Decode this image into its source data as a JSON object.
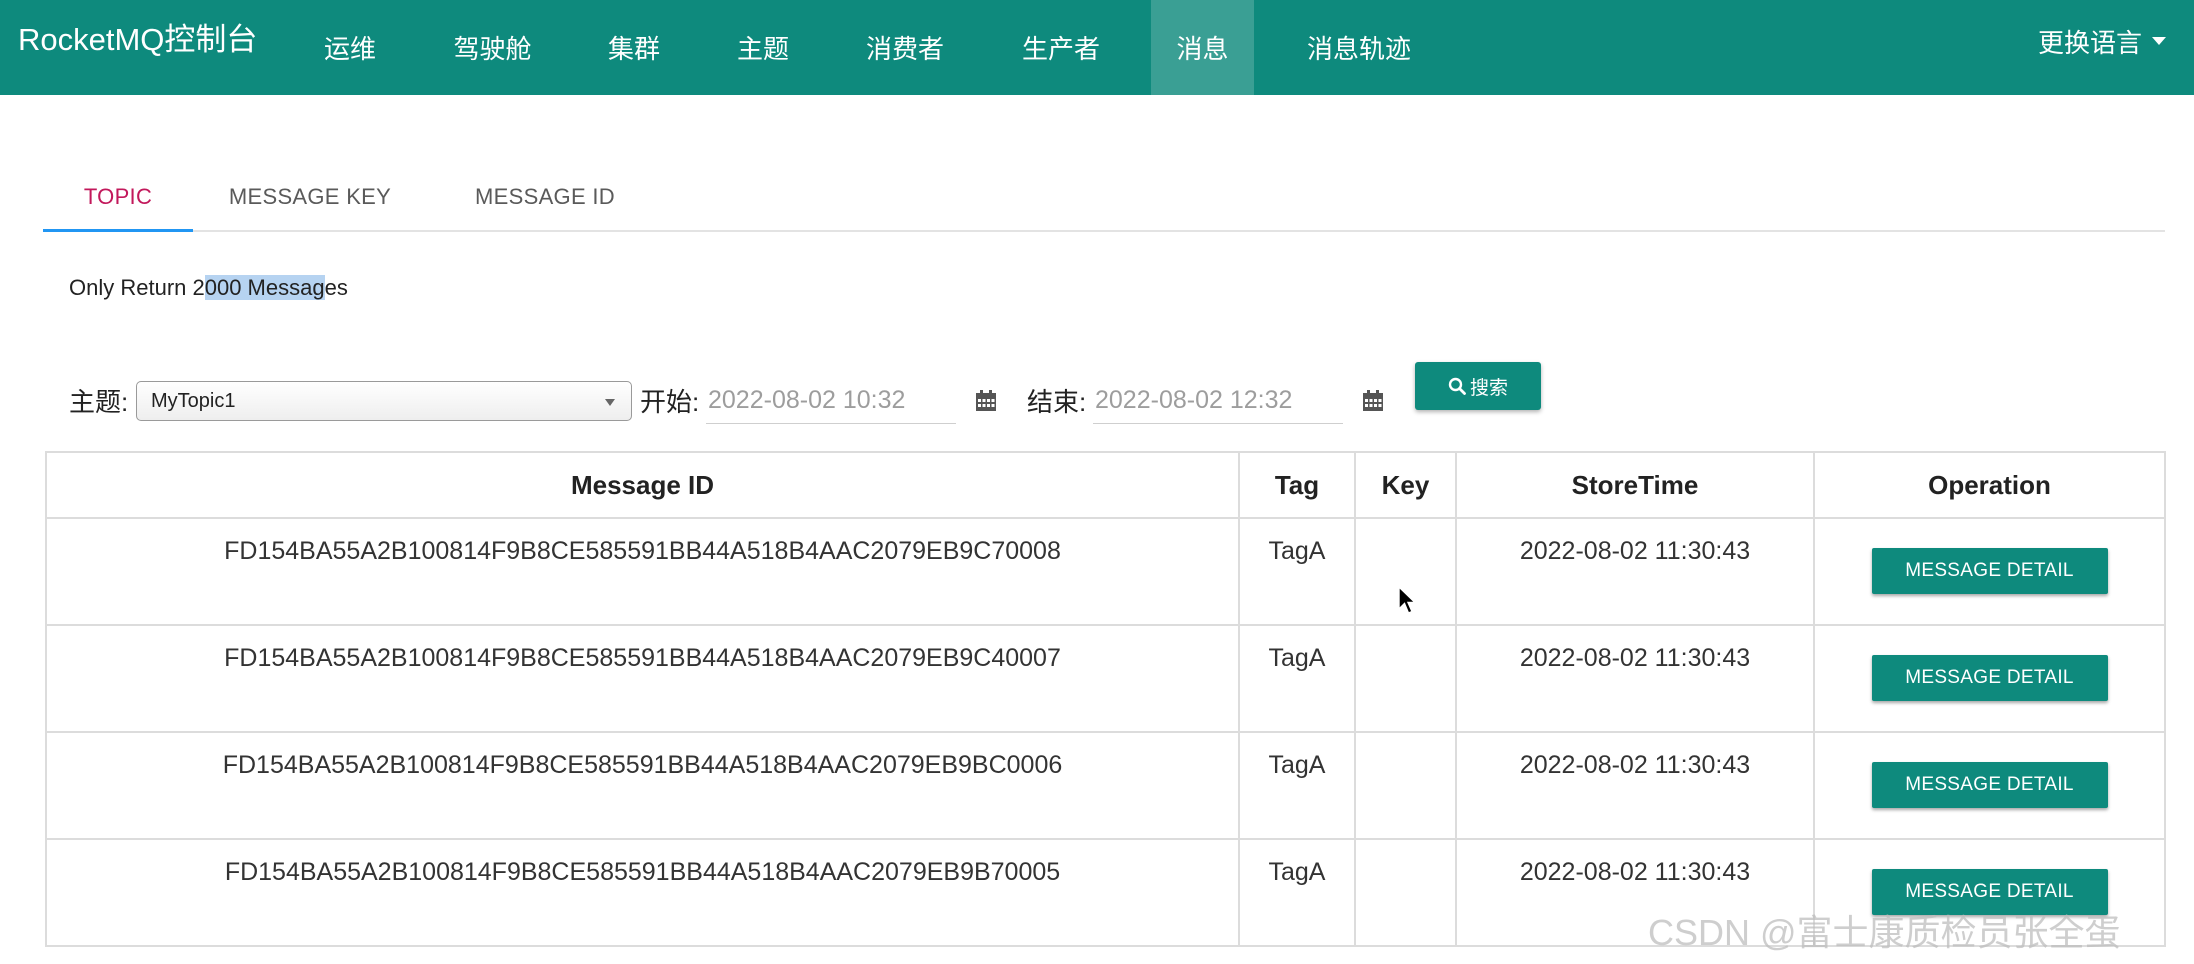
{
  "navbar": {
    "brand": "RocketMQ控制台",
    "items": [
      {
        "label": "运维",
        "active": false
      },
      {
        "label": "驾驶舱",
        "active": false
      },
      {
        "label": "集群",
        "active": false
      },
      {
        "label": "主题",
        "active": false
      },
      {
        "label": "消费者",
        "active": false
      },
      {
        "label": "生产者",
        "active": false
      },
      {
        "label": "消息",
        "active": true
      },
      {
        "label": "消息轨迹",
        "active": false
      }
    ],
    "language_label": "更换语言",
    "colors": {
      "bar": "#0e8a7d",
      "active_item": "#3a9f94"
    }
  },
  "tabs": {
    "items": [
      {
        "label": "TOPIC",
        "active": true
      },
      {
        "label": "MESSAGE KEY",
        "active": false
      },
      {
        "label": "MESSAGE ID",
        "active": false
      }
    ],
    "colors": {
      "active_text": "#c2185b",
      "indicator": "#2196f3"
    }
  },
  "note": {
    "before": "Only Return 2",
    "highlighted": "000 Messag",
    "after": "es"
  },
  "search": {
    "topic_label": "主题:",
    "topic_value": "MyTopic1",
    "start_label": "开始:",
    "start_value": "2022-08-02 10:32",
    "end_label": "结束:",
    "end_value": "2022-08-02 12:32",
    "button_label": "搜索",
    "icons": {
      "calendar": "calendar-icon",
      "search": "search-icon"
    }
  },
  "table": {
    "headers": [
      "Message ID",
      "Tag",
      "Key",
      "StoreTime",
      "Operation"
    ],
    "rows": [
      {
        "id": "FD154BA55A2B100814F9B8CE585591BB44A518B4AAC2079EB9C70008",
        "tag": "TagA",
        "key": "",
        "store_time": "2022-08-02 11:30:43",
        "action": "MESSAGE DETAIL"
      },
      {
        "id": "FD154BA55A2B100814F9B8CE585591BB44A518B4AAC2079EB9C40007",
        "tag": "TagA",
        "key": "",
        "store_time": "2022-08-02 11:30:43",
        "action": "MESSAGE DETAIL"
      },
      {
        "id": "FD154BA55A2B100814F9B8CE585591BB44A518B4AAC2079EB9BC0006",
        "tag": "TagA",
        "key": "",
        "store_time": "2022-08-02 11:30:43",
        "action": "MESSAGE DETAIL"
      },
      {
        "id": "FD154BA55A2B100814F9B8CE585591BB44A518B4AAC2079EB9B70005",
        "tag": "TagA",
        "key": "",
        "store_time": "2022-08-02 11:30:43",
        "action": "MESSAGE DETAIL"
      }
    ],
    "colors": {
      "button": "#0e8a7d"
    }
  },
  "watermark": "CSDN @富士康质检员张全蛋"
}
